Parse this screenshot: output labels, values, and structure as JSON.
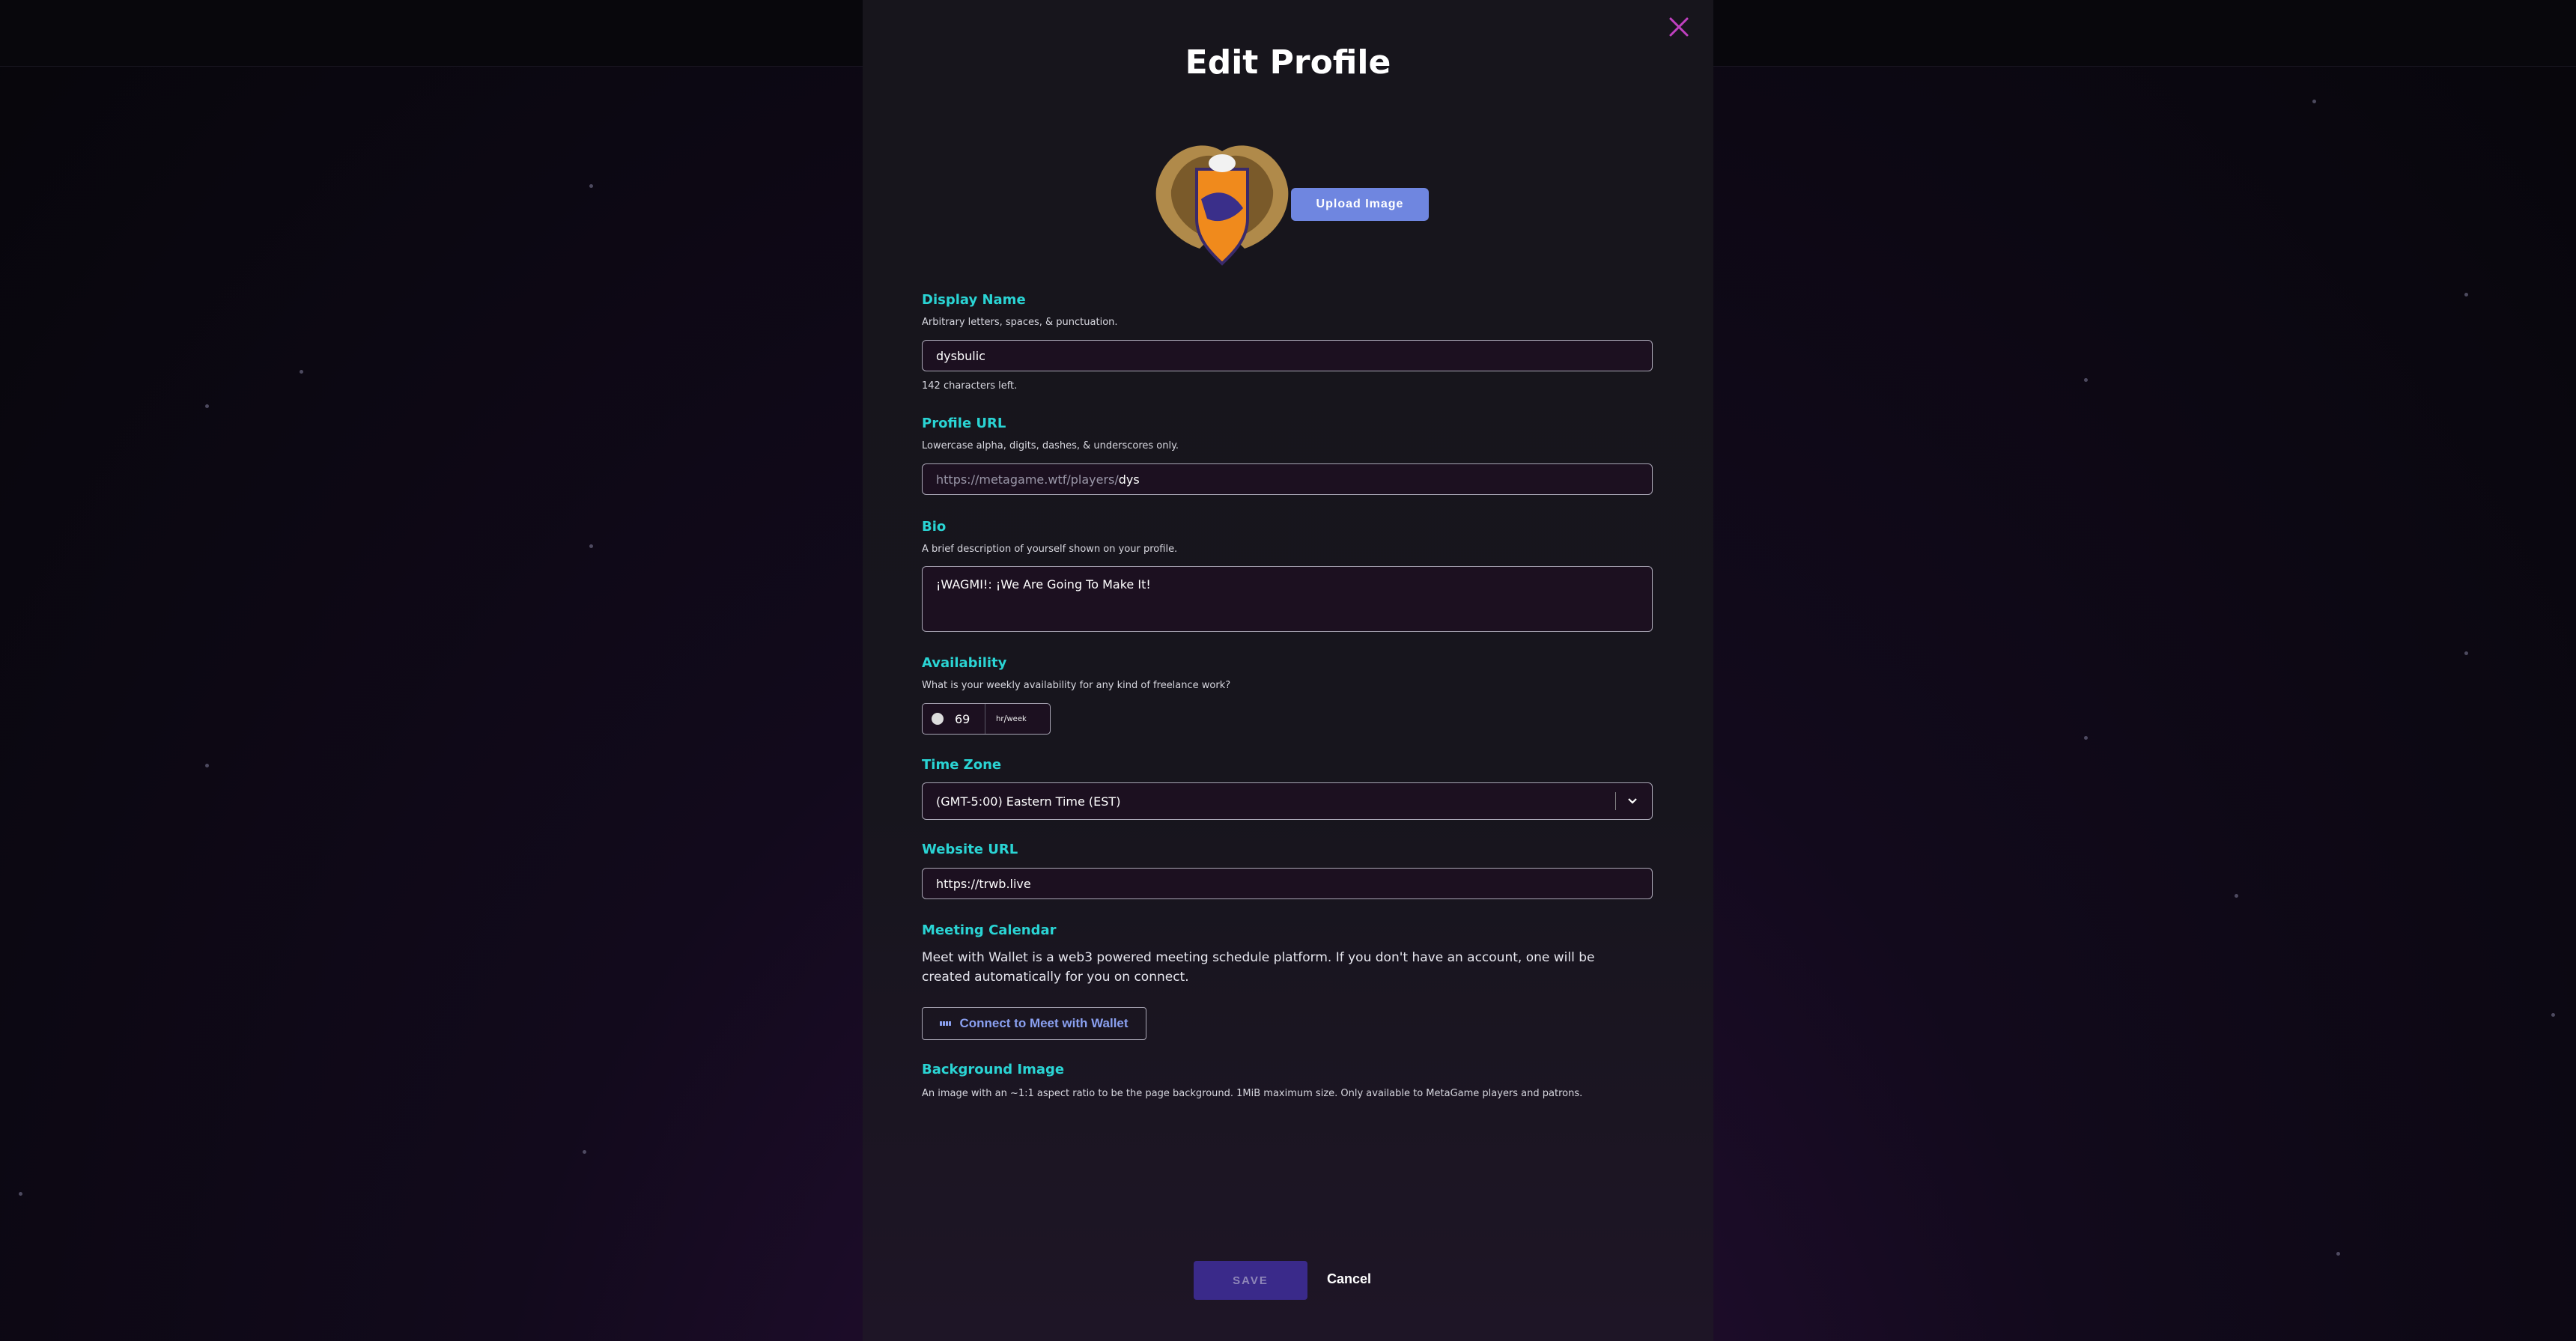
{
  "modal": {
    "title": "Edit Profile",
    "upload_label": "Upload Image",
    "save_label": "SAVE",
    "cancel_label": "Cancel"
  },
  "display_name": {
    "label": "Display Name",
    "help": "Arbitrary letters, spaces, & punctuation.",
    "value": "dysbulic",
    "remaining": "142 characters left."
  },
  "profile_url": {
    "label": "Profile URL",
    "help": "Lowercase alpha, digits, dashes, & underscores only.",
    "prefix": "https://metagame.wtf/players/",
    "value": "dys"
  },
  "bio": {
    "label": "Bio",
    "help": "A brief description of yourself shown on your profile.",
    "value": "¡WAGMI!: ¡We Are Going To Make It!"
  },
  "availability": {
    "label": "Availability",
    "help": "What is your weekly availability for any kind of freelance work?",
    "value": "69",
    "unit_sup": "hr",
    "unit_sub": "week"
  },
  "time_zone": {
    "label": "Time Zone",
    "value": "(GMT-5:00) Eastern Time (EST)"
  },
  "website_url": {
    "label": "Website URL",
    "value": "https://trwb.live"
  },
  "meeting_calendar": {
    "label": "Meeting Calendar",
    "description": "Meet with Wallet is a web3 powered meeting schedule platform. If you don't have an account, one will be created automatically for you on connect.",
    "connect_label": "Connect to Meet with Wallet"
  },
  "background_image": {
    "label": "Background Image",
    "help": "An image with an ~1:1 aspect ratio to be the page background. 1MiB maximum size. Only available to MetaGame players and patrons."
  },
  "colors": {
    "accent_teal": "#2ad4d4",
    "upload_blue": "#6f86e0",
    "save_purple": "#3a2a8a",
    "close_magenta": "#c040c0"
  }
}
